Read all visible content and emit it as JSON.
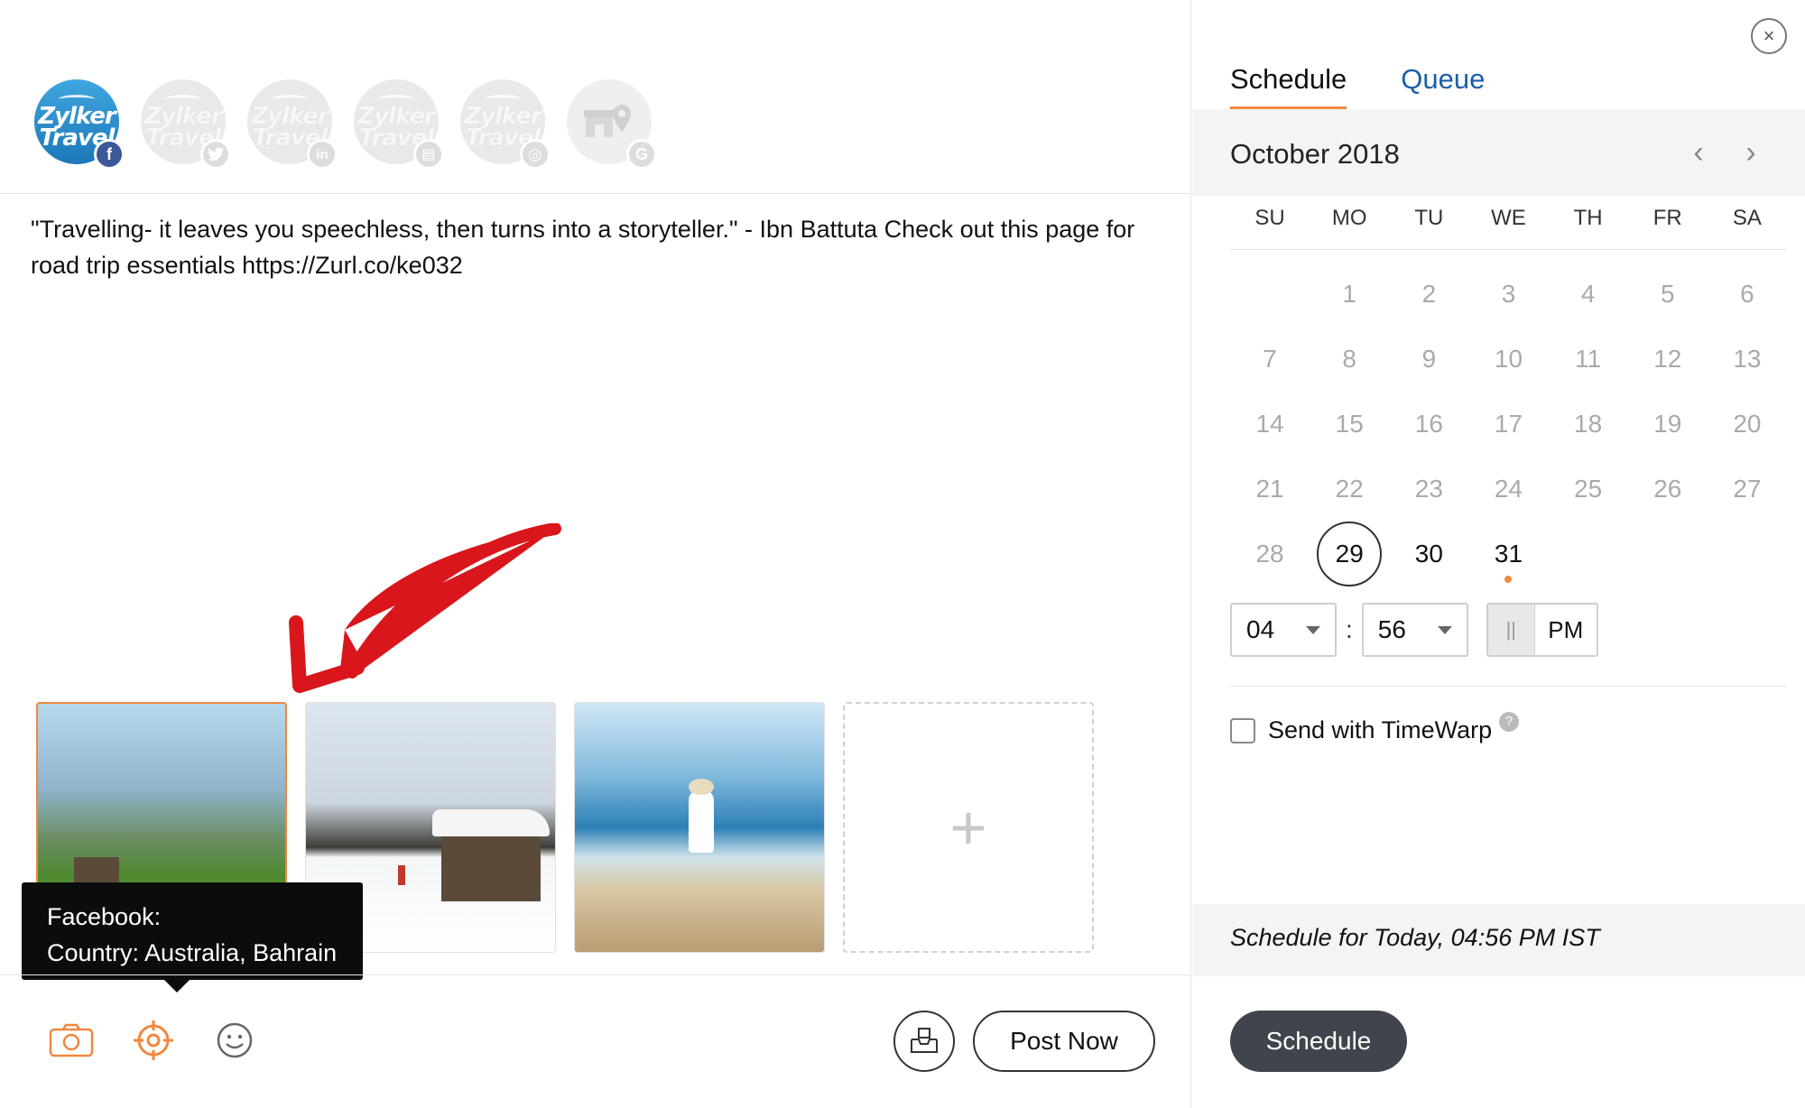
{
  "accounts": [
    {
      "name": "Zylker Travel",
      "network": "facebook-icon",
      "badge": "f",
      "active": true
    },
    {
      "name": "Zylker Travel",
      "network": "twitter-icon",
      "badge": "t",
      "active": false
    },
    {
      "name": "Zylker Travel",
      "network": "linkedin-icon",
      "badge": "in",
      "active": false
    },
    {
      "name": "Zylker Travel",
      "network": "linkedin-page-icon",
      "badge": "▤",
      "active": false
    },
    {
      "name": "Zylker Travel",
      "network": "instagram-icon",
      "badge": "◎",
      "active": false
    },
    {
      "name": "",
      "network": "google-my-business-icon",
      "badge": "G",
      "active": false
    }
  ],
  "logo": {
    "line1": "Zylker",
    "line2": "Travel"
  },
  "post": {
    "text": "\"Travelling- it leaves you speechless, then turns into a storyteller.\" - Ibn Battuta Check out this page for road trip essentials https://Zurl.co/ke032"
  },
  "media": {
    "add_label": "+"
  },
  "tooltip": {
    "line1": "Facebook:",
    "line2": "Country: Australia, Bahrain"
  },
  "footer": {
    "post_now_label": "Post Now"
  },
  "schedule": {
    "close_glyph": "×",
    "tabs": [
      {
        "label": "Schedule"
      },
      {
        "label": "Queue"
      }
    ],
    "month_label": "October 2018",
    "prev_glyph": "‹",
    "next_glyph": "›",
    "weekdays": [
      "SU",
      "MO",
      "TU",
      "WE",
      "TH",
      "FR",
      "SA"
    ],
    "days": [
      {
        "n": "",
        "state": "empty"
      },
      {
        "n": "1",
        "state": "past"
      },
      {
        "n": "2",
        "state": "past"
      },
      {
        "n": "3",
        "state": "past"
      },
      {
        "n": "4",
        "state": "past"
      },
      {
        "n": "5",
        "state": "past"
      },
      {
        "n": "6",
        "state": "past"
      },
      {
        "n": "7",
        "state": "past"
      },
      {
        "n": "8",
        "state": "past"
      },
      {
        "n": "9",
        "state": "past"
      },
      {
        "n": "10",
        "state": "past"
      },
      {
        "n": "11",
        "state": "past"
      },
      {
        "n": "12",
        "state": "past"
      },
      {
        "n": "13",
        "state": "past"
      },
      {
        "n": "14",
        "state": "past"
      },
      {
        "n": "15",
        "state": "past"
      },
      {
        "n": "16",
        "state": "past"
      },
      {
        "n": "17",
        "state": "past"
      },
      {
        "n": "18",
        "state": "past"
      },
      {
        "n": "19",
        "state": "past"
      },
      {
        "n": "20",
        "state": "past"
      },
      {
        "n": "21",
        "state": "past"
      },
      {
        "n": "22",
        "state": "past"
      },
      {
        "n": "23",
        "state": "past"
      },
      {
        "n": "24",
        "state": "past"
      },
      {
        "n": "25",
        "state": "past"
      },
      {
        "n": "26",
        "state": "past"
      },
      {
        "n": "27",
        "state": "past"
      },
      {
        "n": "28",
        "state": "past"
      },
      {
        "n": "29",
        "state": "today"
      },
      {
        "n": "30",
        "state": "avail"
      },
      {
        "n": "31",
        "state": "dot"
      }
    ],
    "hour": "04",
    "minute": "56",
    "time_separator": ":",
    "ampm_knob": "||",
    "ampm": "PM",
    "timewarp_label": "Send with TimeWarp",
    "help_glyph": "?",
    "summary": "Schedule for Today, 04:56 PM  IST",
    "button_label": "Schedule"
  },
  "colors": {
    "accent": "#f0883e",
    "link": "#1b5fa8",
    "facebook": "#3b5998",
    "dark_button": "#3f444d"
  }
}
